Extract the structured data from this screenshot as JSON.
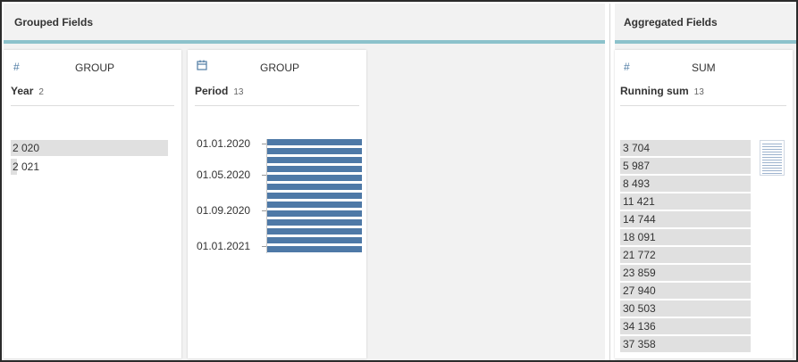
{
  "grouped": {
    "title": "Grouped Fields",
    "year": {
      "icon": "hash-icon",
      "role": "GROUP",
      "field": "Year",
      "count": "2",
      "values": [
        "2 020",
        "2 021"
      ],
      "bar_fractions": [
        1.0,
        0.04
      ]
    },
    "period": {
      "icon": "calendar-icon",
      "role": "GROUP",
      "field": "Period",
      "count": "13",
      "axis_labels": [
        "01.01.2020",
        "01.05.2020",
        "01.09.2020",
        "01.01.2021"
      ],
      "bar_count": 13,
      "bar_color": "#4e79a7"
    }
  },
  "aggregated": {
    "title": "Aggregated Fields",
    "running_sum": {
      "icon": "hash-icon",
      "role": "SUM",
      "field": "Running sum",
      "count": "13",
      "values": [
        "3 704",
        "5 987",
        "8 493",
        "11 421",
        "14 744",
        "18 091",
        "21 772",
        "23 859",
        "27 940",
        "30 503",
        "34 136",
        "37 358"
      ]
    }
  },
  "colors": {
    "accent_teal": "#8cc2cb",
    "bar_blue": "#4e79a7",
    "icon_blue": "#4f7ca4"
  }
}
